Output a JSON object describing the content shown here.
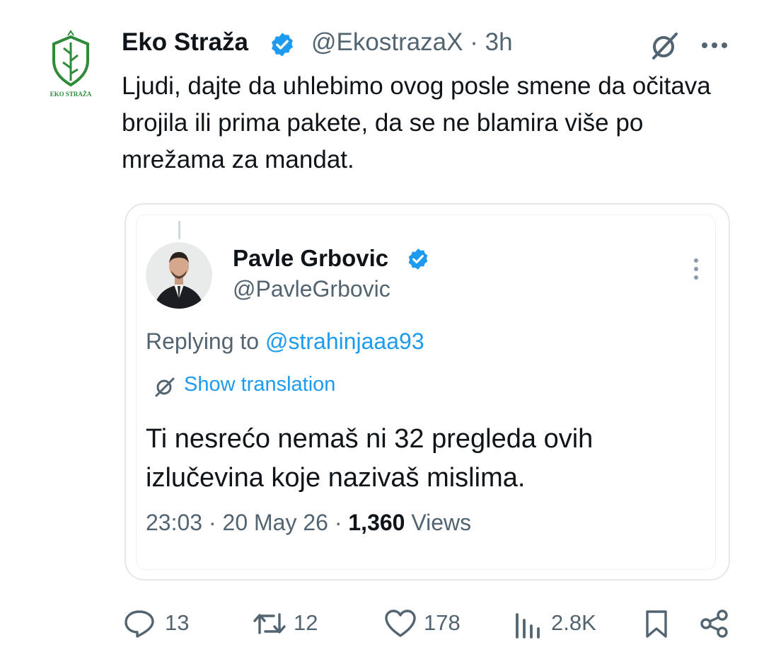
{
  "post": {
    "author_name": "Eko Straža",
    "author_handle": "@EkostrazaX",
    "time": "3h",
    "logo_text": "EKO STRAŽA",
    "text": "Ljudi, dajte da uhlebimo ovog posle smene da očitava brojila ili prima pakete, da se ne blamira više po mrežama za mandat."
  },
  "quote": {
    "author_name": "Pavle Grbovic",
    "author_handle": "@PavleGrbovic",
    "replying_prefix": "Replying to ",
    "replying_to": "@strahinjaaa93",
    "show_translation": "Show translation",
    "text": "Ti nesrećo nemaš ni 32 pregleda ovih izlučevina koje nazivaš mislima.",
    "timestamp": "23:03 · 20 May 26 · ",
    "views_count": "1,360",
    "views_label": " Views"
  },
  "actions": {
    "replies": "13",
    "reposts": "12",
    "likes": "178",
    "views": "2.8K"
  },
  "colors": {
    "verified": "#1d9bf0",
    "link": "#1d9bf0",
    "muted": "#536471",
    "logo_green": "#2e8b3a"
  },
  "icons": [
    "verified-badge-icon",
    "grok-icon",
    "more-horizontal-icon",
    "more-vertical-icon",
    "translate-icon",
    "reply-icon",
    "repost-icon",
    "like-icon",
    "views-icon",
    "bookmark-icon",
    "share-icon"
  ]
}
